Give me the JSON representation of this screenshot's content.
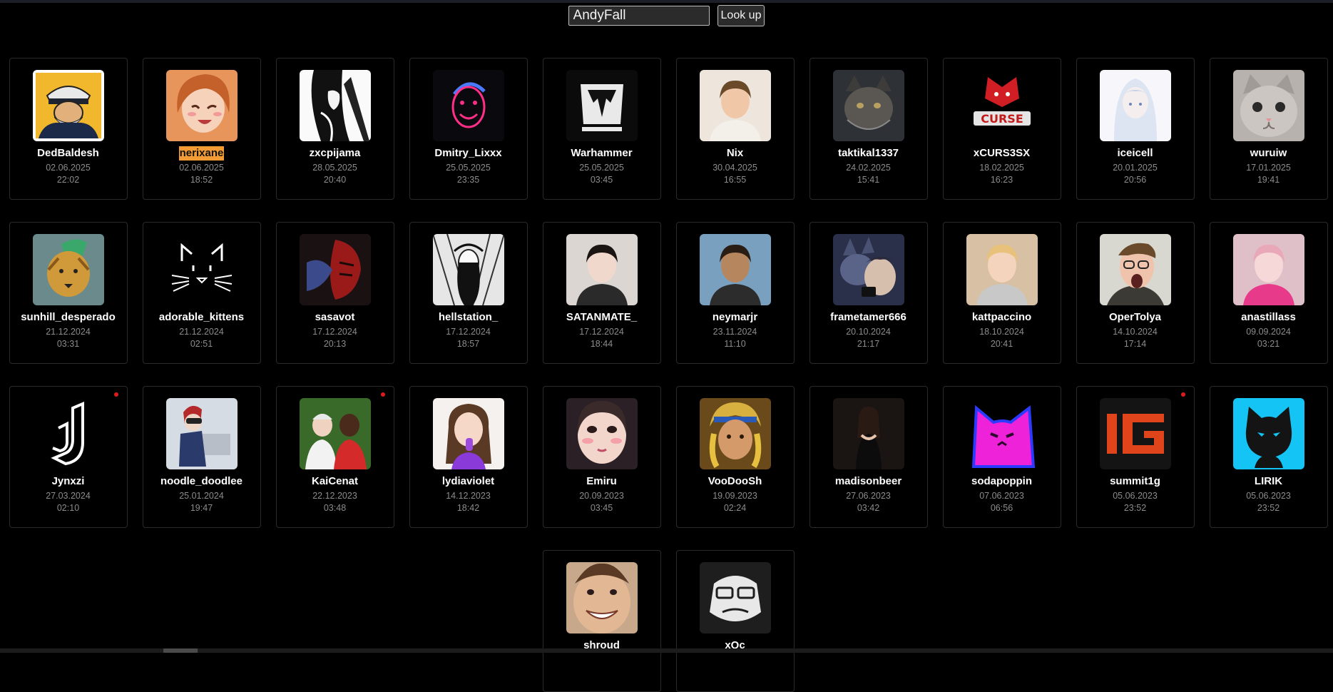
{
  "search": {
    "value": "AndyFall",
    "button_label": "Look up"
  },
  "cards": [
    {
      "name": "DedBaldesh",
      "date": "02.06.2025",
      "time": "22:02",
      "live": false,
      "highlight": false,
      "icon": "captain-avatar-icon"
    },
    {
      "name": "nerixane",
      "date": "02.06.2025",
      "time": "18:52",
      "live": false,
      "highlight": true,
      "icon": "anime-girl-avatar-icon"
    },
    {
      "name": "zxcpijama",
      "date": "28.05.2025",
      "time": "20:40",
      "live": false,
      "highlight": false,
      "icon": "sketch-character-avatar-icon"
    },
    {
      "name": "Dmitry_Lixxx",
      "date": "25.05.2025",
      "time": "23:35",
      "live": false,
      "highlight": false,
      "icon": "neon-face-avatar-icon"
    },
    {
      "name": "Warhammer",
      "date": "25.05.2025",
      "time": "03:45",
      "live": false,
      "highlight": false,
      "icon": "warhammer-logo-icon"
    },
    {
      "name": "Nix",
      "date": "30.04.2025",
      "time": "16:55",
      "live": false,
      "highlight": false,
      "icon": "person-avatar-icon"
    },
    {
      "name": "taktikal1337",
      "date": "24.02.2025",
      "time": "15:41",
      "live": false,
      "highlight": false,
      "icon": "cat-avatar-icon"
    },
    {
      "name": "xCURS3SX",
      "date": "18.02.2025",
      "time": "16:23",
      "live": false,
      "highlight": false,
      "icon": "curse-logo-icon"
    },
    {
      "name": "iceicell",
      "date": "20.01.2025",
      "time": "20:56",
      "live": false,
      "highlight": false,
      "icon": "anime-white-avatar-icon"
    },
    {
      "name": "wuruiw",
      "date": "17.01.2025",
      "time": "19:41",
      "live": false,
      "highlight": false,
      "icon": "kitten-avatar-icon"
    },
    {
      "name": "sunhill_desperado",
      "date": "21.12.2024",
      "time": "03:31",
      "live": false,
      "highlight": false,
      "icon": "lion-avatar-icon"
    },
    {
      "name": "adorable_kittens",
      "date": "21.12.2024",
      "time": "02:51",
      "live": false,
      "highlight": false,
      "icon": "cat-face-logo-icon"
    },
    {
      "name": "sasavot",
      "date": "17.12.2024",
      "time": "20:13",
      "live": false,
      "highlight": false,
      "icon": "masked-warrior-avatar-icon"
    },
    {
      "name": "hellstation_",
      "date": "17.12.2024",
      "time": "18:57",
      "live": false,
      "highlight": false,
      "icon": "manga-art-avatar-icon"
    },
    {
      "name": "SATANMATE_",
      "date": "17.12.2024",
      "time": "18:44",
      "live": false,
      "highlight": false,
      "icon": "person-avatar-icon"
    },
    {
      "name": "neymarjr",
      "date": "23.11.2024",
      "time": "11:10",
      "live": false,
      "highlight": false,
      "icon": "person-avatar-icon"
    },
    {
      "name": "frametamer666",
      "date": "20.10.2024",
      "time": "21:17",
      "live": false,
      "highlight": false,
      "icon": "cartoon-wolf-avatar-icon"
    },
    {
      "name": "kattpaccino",
      "date": "18.10.2024",
      "time": "20:41",
      "live": false,
      "highlight": false,
      "icon": "person-avatar-icon"
    },
    {
      "name": "OperTolya",
      "date": "14.10.2024",
      "time": "17:14",
      "live": false,
      "highlight": false,
      "icon": "person-avatar-icon"
    },
    {
      "name": "anastillass",
      "date": "09.09.2024",
      "time": "03:21",
      "live": false,
      "highlight": false,
      "icon": "person-avatar-icon"
    },
    {
      "name": "Jynxzi",
      "date": "27.03.2024",
      "time": "02:10",
      "live": true,
      "highlight": false,
      "icon": "jynxzi-logo-icon"
    },
    {
      "name": "noodle_doodlee",
      "date": "25.01.2024",
      "time": "19:47",
      "live": false,
      "highlight": false,
      "icon": "anime-character-avatar-icon"
    },
    {
      "name": "KaiCenat",
      "date": "22.12.2023",
      "time": "03:48",
      "live": true,
      "highlight": false,
      "icon": "person-avatar-icon"
    },
    {
      "name": "lydiaviolet",
      "date": "14.12.2023",
      "time": "18:42",
      "live": false,
      "highlight": false,
      "icon": "person-avatar-icon"
    },
    {
      "name": "Emiru",
      "date": "20.09.2023",
      "time": "03:45",
      "live": false,
      "highlight": false,
      "icon": "person-avatar-icon"
    },
    {
      "name": "VooDooSh",
      "date": "19.09.2023",
      "time": "02:24",
      "live": false,
      "highlight": false,
      "icon": "painted-king-avatar-icon"
    },
    {
      "name": "madisonbeer",
      "date": "27.06.2023",
      "time": "03:42",
      "live": false,
      "highlight": false,
      "icon": "person-avatar-icon"
    },
    {
      "name": "sodapoppin",
      "date": "07.06.2023",
      "time": "06:56",
      "live": false,
      "highlight": false,
      "icon": "magenta-cat-logo-icon"
    },
    {
      "name": "summit1g",
      "date": "05.06.2023",
      "time": "23:52",
      "live": true,
      "highlight": false,
      "icon": "1g-logo-icon"
    },
    {
      "name": "LIRIK",
      "date": "05.06.2023",
      "time": "23:52",
      "live": false,
      "highlight": false,
      "icon": "black-cat-logo-icon"
    },
    {
      "name": "shroud",
      "date": "",
      "time": "",
      "live": false,
      "highlight": false,
      "icon": "person-avatar-icon"
    },
    {
      "name": "xQc",
      "date": "",
      "time": "",
      "live": false,
      "highlight": false,
      "icon": "gorilla-logo-icon"
    }
  ],
  "colors": {
    "background": "#000000",
    "card_border": "#2a2a2a",
    "highlight": "#f39c35",
    "live_dot": "#e01b1b",
    "meta_text": "#8c8c8c"
  }
}
